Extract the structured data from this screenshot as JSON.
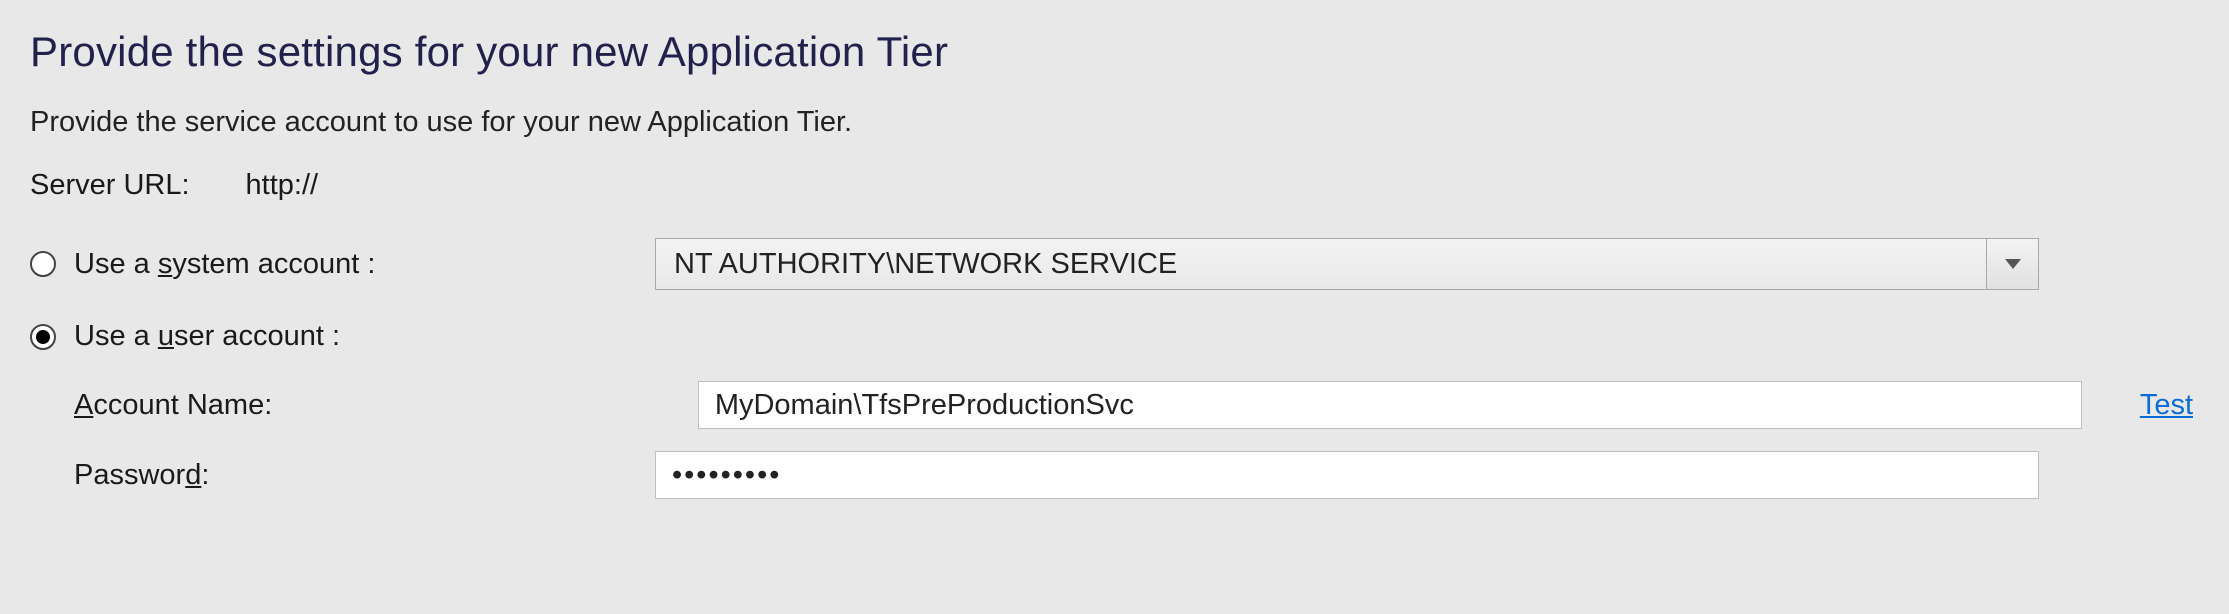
{
  "heading": "Provide the settings for your new Application Tier",
  "subheading": "Provide the service account to use for your new Application Tier.",
  "server_url": {
    "label": "Server URL:",
    "value": "http://"
  },
  "system_account": {
    "label_pre": "Use a ",
    "label_u": "s",
    "label_post": "ystem account :",
    "selected": "NT AUTHORITY\\NETWORK SERVICE"
  },
  "user_account": {
    "label_pre": "Use a ",
    "label_u": "u",
    "label_post": "ser account :"
  },
  "account_name": {
    "label_u": "A",
    "label_post": "ccount Name:",
    "value": "MyDomain\\TfsPreProductionSvc"
  },
  "password": {
    "label_pre": "Passwor",
    "label_u": "d",
    "label_post": ":",
    "value": "•••••••••"
  },
  "test_link": "Test"
}
